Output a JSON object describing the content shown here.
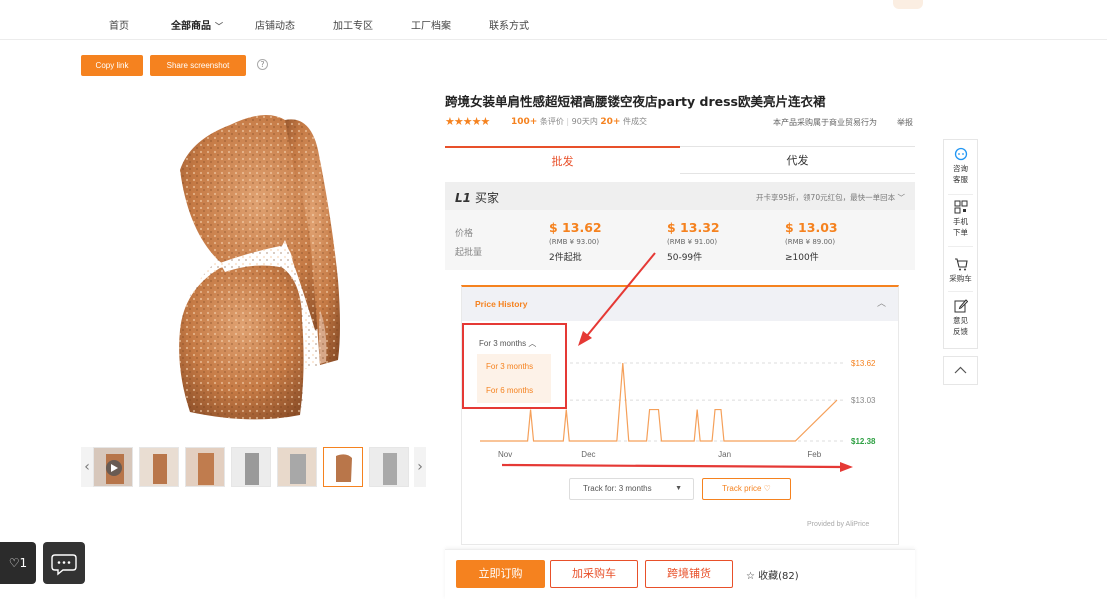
{
  "nav": {
    "items": [
      "首页",
      "全部商品",
      "店铺动态",
      "加工专区",
      "工厂档案",
      "联系方式"
    ],
    "active_index": 1
  },
  "actions": {
    "copy_link": "Copy link",
    "share_screenshot": "Share screenshot"
  },
  "product": {
    "title": "跨境女装单肩性感超短裙高腰镂空夜店party dress欧美亮片连衣裙",
    "rating_stars": 5,
    "reviews_count": "100+",
    "reviews_label": "条评价",
    "sold_prefix": "90天内",
    "sold_count": "20+",
    "sold_label": "件成交",
    "business_note": "本产品采购属于商业贸易行为",
    "report": "举报"
  },
  "tabs": [
    "批发",
    "代发"
  ],
  "pricing": {
    "buyer_level": "L1",
    "buyer_label": "买家",
    "promo": "开卡享95折，领70元红包，最快一单回本",
    "price_label": "价格",
    "moq_label": "起批量",
    "tiers": [
      {
        "price": "$ 13.62",
        "rmb": "(RMB ¥ 93.00)",
        "qty": "2件起批"
      },
      {
        "price": "$ 13.32",
        "rmb": "(RMB ¥ 91.00)",
        "qty": "50-99件"
      },
      {
        "price": "$ 13.03",
        "rmb": "(RMB ¥ 89.00)",
        "qty": "≥100件"
      }
    ]
  },
  "price_history": {
    "title": "Price History",
    "range_selected": "For 3 months",
    "range_options": [
      "For 3 months",
      "For 6 months"
    ],
    "track_for": "Track for: 3 months",
    "track_price": "Track price ♡",
    "provided_by": "Provided by AliPrice",
    "colors": {
      "line": "#f5a05a",
      "high": "#f5821f",
      "mid": "#888888",
      "low": "#2ea043",
      "annotation": "#e53935"
    }
  },
  "chart_data": {
    "type": "line",
    "title": "",
    "x_ticks": [
      "Nov",
      "Dec",
      "Jan",
      "Feb"
    ],
    "y_labels": [
      "$13.62",
      "$13.03",
      "$12.38"
    ],
    "ylim": [
      12.38,
      13.62
    ],
    "series": [
      {
        "points": [
          [
            0,
            12.38
          ],
          [
            6,
            12.38
          ],
          [
            8,
            12.38
          ],
          [
            8.5,
            12.88
          ],
          [
            9,
            12.38
          ],
          [
            14,
            12.38
          ],
          [
            14.5,
            12.88
          ],
          [
            15,
            12.38
          ],
          [
            23,
            12.38
          ],
          [
            24,
            13.62
          ],
          [
            25,
            12.38
          ],
          [
            28,
            12.38
          ],
          [
            28.5,
            12.88
          ],
          [
            30,
            12.88
          ],
          [
            30.5,
            12.38
          ],
          [
            36,
            12.38
          ],
          [
            36.5,
            12.88
          ],
          [
            37,
            12.38
          ],
          [
            39,
            12.38
          ],
          [
            39.5,
            12.88
          ],
          [
            40.5,
            12.88
          ],
          [
            41,
            12.38
          ],
          [
            53,
            12.38
          ],
          [
            60,
            13.03
          ]
        ]
      }
    ]
  },
  "buttons": {
    "buy_now": "立即订购",
    "add_cart": "加采购车",
    "cross_border": "跨境铺货",
    "favorite": "☆ 收藏(82)"
  },
  "sidebar": {
    "items": [
      "咨询客服",
      "手机下单",
      "采购车",
      "意见反馈"
    ]
  },
  "floating": {
    "likes": "♡1"
  },
  "thumbnails_count": 7,
  "selected_thumbnail": 5
}
